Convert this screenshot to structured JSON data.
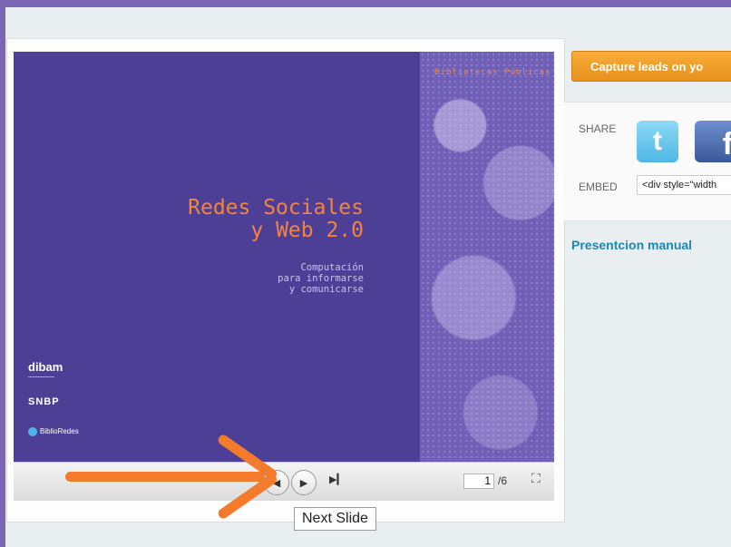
{
  "slide": {
    "tag": "Bibliotecas Públicas",
    "title_line1": "Redes Sociales",
    "title_line2": "y Web 2.0",
    "subtitle_line1": "Computación",
    "subtitle_line2": "para informarse",
    "subtitle_line3": "y comunicarse",
    "logo_dibam": "dibam",
    "logo_snbp": "SNBP",
    "logo_biblioredes": "BiblioRedes"
  },
  "player": {
    "current_page": "1",
    "total_pages": "/6",
    "tooltip": "Next Slide"
  },
  "sidebar": {
    "capture_button": "Capture leads on yo",
    "share_label": "SHARE",
    "embed_label": "EMBED",
    "embed_value": "<div style=\"width",
    "related_title": "Presentcion manual"
  },
  "colors": {
    "slide_bg": "#4d3f96",
    "accent_orange": "#f47b2c",
    "link_blue": "#1d86b5"
  }
}
